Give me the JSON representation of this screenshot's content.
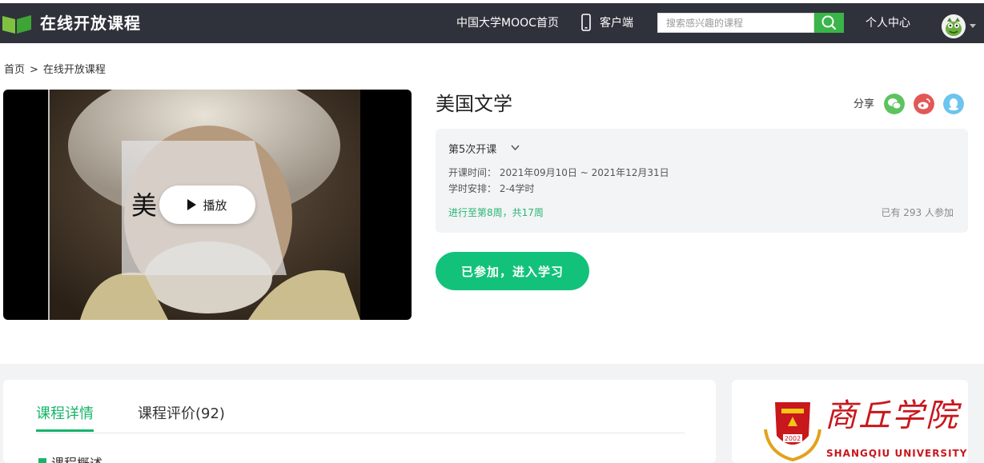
{
  "header": {
    "site_name": "在线开放课程",
    "nav_home": "中国大学MOOC首页",
    "nav_app": "客户端",
    "search_placeholder": "搜索感兴趣的课程",
    "nav_personal": "个人中心"
  },
  "breadcrumb": {
    "home": "首页",
    "separator": ">",
    "current": "在线开放课程"
  },
  "video": {
    "play_label": "播放",
    "book_title_glyph": "美"
  },
  "course": {
    "title": "美国文学",
    "share_label": "分享",
    "share_targets": [
      "wechat-icon",
      "weibo-icon",
      "qq-icon"
    ],
    "term": "第5次开课",
    "schedule_label": "开课时间：",
    "schedule_value": "2021年09月10日 ~ 2021年12月31日",
    "workload_label": "学时安排：",
    "workload_value": "2-4学时",
    "progress": "进行至第8周，共17周",
    "enrolled": "已有 293 人参加",
    "join_button": "已参加，进入学习"
  },
  "details": {
    "tabs": [
      {
        "label": "课程详情",
        "active": true
      },
      {
        "label": "课程评价(92)",
        "active": false
      }
    ],
    "section_peek": "课程概述"
  },
  "school": {
    "name_cn": "商丘学院",
    "name_en": "SHANGQIU UNIVERSITY",
    "emblem_year": "2002"
  },
  "colors": {
    "topbar": "#2f323b",
    "accent_green": "#13c27a",
    "search_green": "#3ab549",
    "school_red": "#c8171d"
  }
}
